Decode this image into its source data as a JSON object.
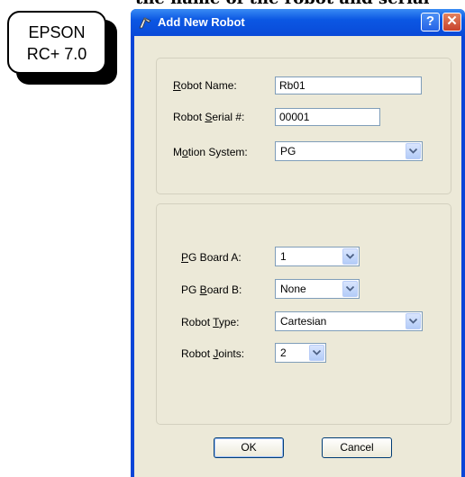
{
  "doc": {
    "cut_text": "the name of the robot and serial"
  },
  "badge": {
    "line1": "EPSON",
    "line2": "RC+ 7.0"
  },
  "dialog": {
    "title": "Add New Robot",
    "help_glyph": "?",
    "close_glyph": "✕",
    "labels": {
      "robot_name": {
        "pre": "",
        "ul": "R",
        "post": "obot Name:"
      },
      "robot_serial": {
        "pre": "Robot ",
        "ul": "S",
        "post": "erial #:"
      },
      "motion_system": {
        "pre": "M",
        "ul": "o",
        "post": "tion System:"
      },
      "pg_board_a": {
        "pre": "",
        "ul": "P",
        "post": "G Board A:"
      },
      "pg_board_b": {
        "pre": "PG ",
        "ul": "B",
        "post": "oard B:"
      },
      "robot_type": {
        "pre": "Robot ",
        "ul": "T",
        "post": "ype:"
      },
      "robot_joints": {
        "pre": "Robot ",
        "ul": "J",
        "post": "oints:"
      }
    },
    "values": {
      "robot_name": "Rb01",
      "robot_serial": "00001",
      "motion_system": "PG",
      "pg_board_a": "1",
      "pg_board_b": "None",
      "robot_type": "Cartesian",
      "robot_joints": "2"
    },
    "buttons": {
      "ok": "OK",
      "cancel": "Cancel"
    }
  }
}
